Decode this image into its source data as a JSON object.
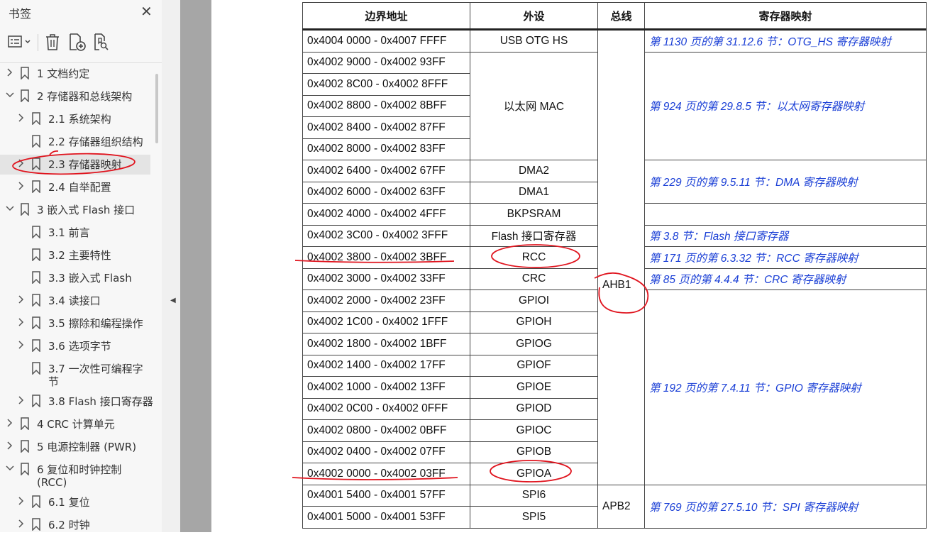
{
  "sidebar": {
    "title": "书签",
    "close_icon": "close-icon",
    "toolbar": [
      "outline-options-icon",
      "delete-icon",
      "add-bookmark-icon",
      "find-bookmark-icon"
    ],
    "items": [
      {
        "label": "1 文档约定",
        "level": 1,
        "state": "collapsed"
      },
      {
        "label": "2 存储器和总线架构",
        "level": 1,
        "state": "expanded"
      },
      {
        "label": "2.1 系统架构",
        "level": 2,
        "state": "collapsed"
      },
      {
        "label": "2.2 存储器组织结构",
        "level": 2,
        "state": "none"
      },
      {
        "label": "2.3 存储器映射",
        "level": 2,
        "state": "collapsed",
        "selected": true
      },
      {
        "label": "2.4 自举配置",
        "level": 2,
        "state": "collapsed"
      },
      {
        "label": "3 嵌入式 Flash 接口",
        "level": 1,
        "state": "expanded"
      },
      {
        "label": "3.1 前言",
        "level": 2,
        "state": "none"
      },
      {
        "label": "3.2 主要特性",
        "level": 2,
        "state": "none"
      },
      {
        "label": "3.3 嵌入式 Flash",
        "level": 2,
        "state": "none"
      },
      {
        "label": "3.4 读接口",
        "level": 2,
        "state": "collapsed"
      },
      {
        "label": "3.5 擦除和编程操作",
        "level": 2,
        "state": "collapsed"
      },
      {
        "label": "3.6 选项字节",
        "level": 2,
        "state": "collapsed"
      },
      {
        "label": "3.7 一次性可编程字",
        "label2": "节",
        "level": 2,
        "state": "none"
      },
      {
        "label": "3.8 Flash 接口寄存器",
        "level": 2,
        "state": "collapsed"
      },
      {
        "label": "4 CRC 计算单元",
        "level": 1,
        "state": "collapsed"
      },
      {
        "label": "5 电源控制器 (PWR)",
        "level": 1,
        "state": "collapsed"
      },
      {
        "label": "6 复位和时钟控制",
        "label2": "(RCC)",
        "level": 1,
        "state": "expanded"
      },
      {
        "label": "6.1 复位",
        "level": 2,
        "state": "collapsed"
      },
      {
        "label": "6.2 时钟",
        "level": 2,
        "state": "collapsed"
      }
    ]
  },
  "table": {
    "headers": [
      "边界地址",
      "外设",
      "总线",
      "寄存器映射"
    ],
    "rows": [
      {
        "addr": "0x4004 0000 - 0x4007 FFFF",
        "per": "USB OTG HS"
      },
      {
        "addr": "0x4002 9000 - 0x4002 93FF",
        "per": ""
      },
      {
        "addr": "0x4002 8C00 - 0x4002 8FFF",
        "per": ""
      },
      {
        "addr": "0x4002 8800 - 0x4002 8BFF",
        "per": ""
      },
      {
        "addr": "0x4002 8400 - 0x4002 87FF",
        "per": ""
      },
      {
        "addr": "0x4002 8000 - 0x4002 83FF",
        "per": ""
      },
      {
        "addr": "0x4002 6400 - 0x4002 67FF",
        "per": "DMA2"
      },
      {
        "addr": "0x4002 6000 - 0x4002 63FF",
        "per": "DMA1"
      },
      {
        "addr": "0x4002 4000 - 0x4002 4FFF",
        "per": "BKPSRAM"
      },
      {
        "addr": "0x4002 3C00 - 0x4002 3FFF",
        "per": "Flash 接口寄存器"
      },
      {
        "addr": "0x4002 3800 - 0x4002 3BFF",
        "per": "RCC"
      },
      {
        "addr": "0x4002 3000 - 0x4002 33FF",
        "per": "CRC"
      },
      {
        "addr": "0x4002 2000 - 0x4002 23FF",
        "per": "GPIOI"
      },
      {
        "addr": "0x4002 1C00 - 0x4002 1FFF",
        "per": "GPIOH"
      },
      {
        "addr": "0x4002 1800 - 0x4002 1BFF",
        "per": "GPIOG"
      },
      {
        "addr": "0x4002 1400 - 0x4002 17FF",
        "per": "GPIOF"
      },
      {
        "addr": "0x4002 1000 - 0x4002 13FF",
        "per": "GPIOE"
      },
      {
        "addr": "0x4002 0C00 - 0x4002 0FFF",
        "per": "GPIOD"
      },
      {
        "addr": "0x4002 0800 - 0x4002 0BFF",
        "per": "GPIOC"
      },
      {
        "addr": "0x4002 0400 - 0x4002 07FF",
        "per": "GPIOB"
      },
      {
        "addr": "0x4002 0000 - 0x4002 03FF",
        "per": "GPIOA"
      },
      {
        "addr": "0x4001 5400 - 0x4001 57FF",
        "per": "SPI6"
      },
      {
        "addr": "0x4001 5000 - 0x4001 53FF",
        "per": "SPI5"
      }
    ],
    "ethernet_label": "以太网 MAC",
    "bus_ahb1": "AHB1",
    "bus_apb2": "APB2",
    "refs": [
      "第 1130 页的第 31.12.6 节：OTG_HS 寄存器映射",
      "第 924 页的第 29.8.5 节：以太网寄存器映射",
      "第 229 页的第 9.5.11 节：DMA 寄存器映射",
      "",
      "第 3.8 节：Flash 接口寄存器",
      "第 171 页的第 6.3.32 节：RCC 寄存器映射",
      "第 85 页的第 4.4.4 节：CRC 寄存器映射",
      "第 192 页的第 7.4.11 节：GPIO 寄存器映射",
      "第 769 页的第 27.5.10 节：SPI 寄存器映射"
    ],
    "link_color": "#1a3fd6"
  },
  "annotation_color": "#e0141e"
}
